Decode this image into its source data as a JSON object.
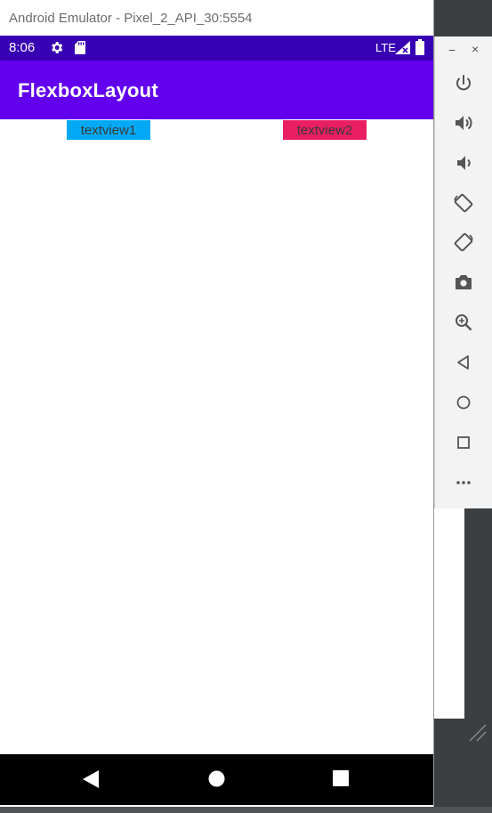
{
  "window": {
    "title": "Android Emulator - Pixel_2_API_30:5554"
  },
  "status_bar": {
    "time": "8:06",
    "network": "LTE"
  },
  "app_bar": {
    "title": "FlexboxLayout"
  },
  "content": {
    "textviews": [
      {
        "label": "textview1",
        "color": "#03a9f4"
      },
      {
        "label": "textview2",
        "color": "#e91e63"
      }
    ]
  },
  "toolbar": {
    "minimize": "−",
    "close": "×",
    "items": [
      "power-icon",
      "volume-up-icon",
      "volume-down-icon",
      "rotate-left-icon",
      "rotate-right-icon",
      "camera-icon",
      "zoom-icon",
      "back-icon",
      "home-icon",
      "overview-icon",
      "more-icon"
    ]
  },
  "colors": {
    "primary": "#6200ee",
    "primary_dark": "#3700b3"
  }
}
